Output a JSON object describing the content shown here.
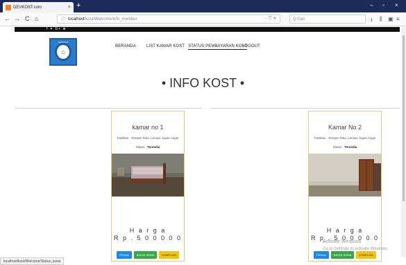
{
  "browser": {
    "tab_title": "DEVKOST.com",
    "tab_close": "×",
    "new_tab": "+",
    "url_host": "localhost",
    "url_path": "/kost/Welcome/info_member",
    "url_icons": "··· ⛉ ☆",
    "search_placeholder": "Q Cari",
    "back": "←",
    "forward": "→",
    "reload": "C",
    "home": "⌂",
    "minimize": "–",
    "maximize": "▫",
    "close": "×",
    "status_url": "localhost/kost/Welcome/Status_sewa"
  },
  "site": {
    "social": "f ✦ G+ ⊕",
    "logo_caption": "DEVKOST",
    "logo_mark": "⌂",
    "nav": [
      {
        "label": "BERANDA"
      },
      {
        "label": "LIST KAMAR KOST"
      },
      {
        "label": "STATUS PEMBAYARAN KOST"
      },
      {
        "label": "LOGOUT"
      }
    ],
    "heading": "• INFO KOST •"
  },
  "rooms": [
    {
      "title": "kamar no 1",
      "facilities": "Fasilitas : Tempat Tidur, Lemari, Kipas Angin",
      "status_label": "Status :",
      "status_value": "Tersedia",
      "price_label": "H a r g a",
      "price": "R p . 5 0 0 0 0 0",
      "buttons": [
        "PESAN",
        "BAYAR SEWA",
        "KOMPLAIN"
      ]
    },
    {
      "title": "Kamar No 2",
      "facilities": "Fasilitas : Tempat Tidur, Lemari, Kipas Angin",
      "status_label": "Status :",
      "status_value": "Tersedia",
      "price_label": "H a r g a",
      "price": "R p . 5 0 0 0 0 0",
      "buttons": [
        "PESAN",
        "BAYAR SEWA",
        "KOMPLAIN"
      ]
    }
  ],
  "watermark": {
    "line1": "Activate Windows",
    "line2": "Go to Settings to activate Windows."
  }
}
